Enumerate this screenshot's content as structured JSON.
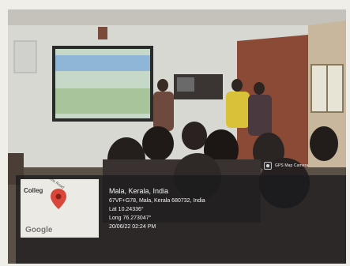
{
  "badge": {
    "text": "GPS Map Camera",
    "icon": "camera-icon"
  },
  "geo": {
    "place": "Mala, Kerala, India",
    "address": "67VF+G78, Mala, Kerala 680732, India",
    "lat": "Lat 10.24336°",
    "long": "Long 76.273047°",
    "datetime": "20/06/22 02:24 PM"
  },
  "map": {
    "label": "Colleg",
    "road_label": "Link Road",
    "logo": "Google",
    "pin_color": "#d9473a"
  }
}
